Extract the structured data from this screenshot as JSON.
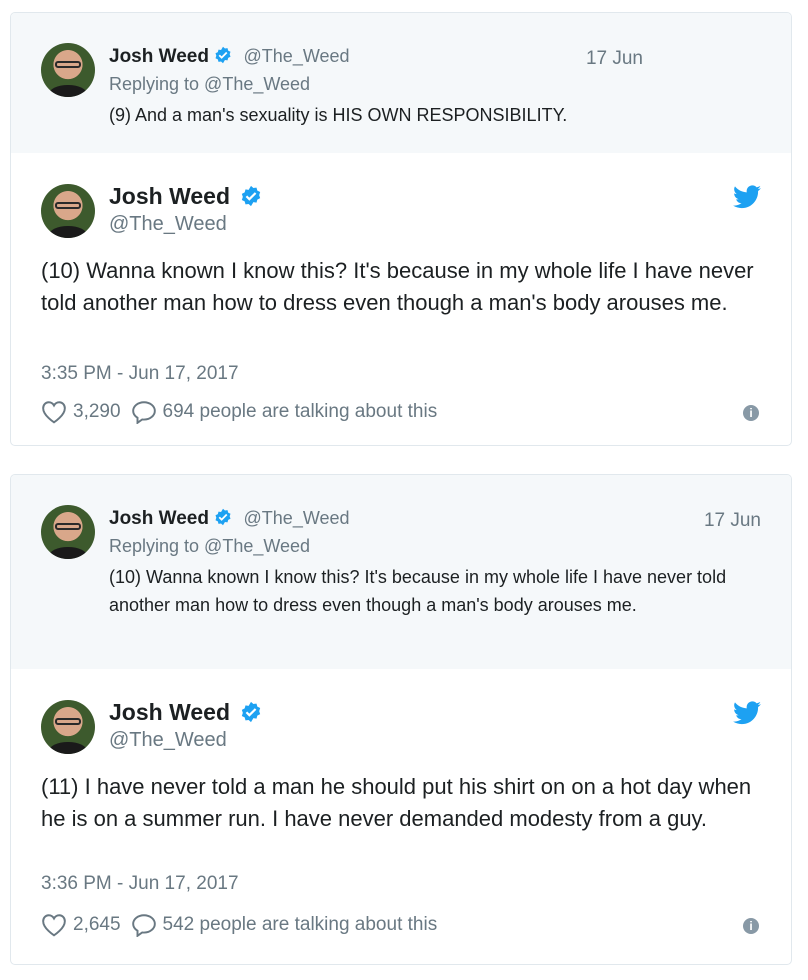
{
  "tweets": [
    {
      "reply": {
        "name": "Josh Weed",
        "handle": "@The_Weed",
        "date": "17 Jun",
        "replying_to": "Replying to @The_Weed",
        "text": "(9) And a man's sexuality is HIS OWN RESPONSIBILITY."
      },
      "main": {
        "name": "Josh Weed",
        "handle": "@The_Weed",
        "text": "(10) Wanna known I know this? It's because in my whole life I have never told another man how to dress even though a man's body arouses me.",
        "time": "3:35 PM - Jun 17, 2017",
        "likes": "3,290",
        "talking": "694 people are talking about this"
      }
    },
    {
      "reply": {
        "name": "Josh Weed",
        "handle": "@The_Weed",
        "date": "17 Jun",
        "replying_to": "Replying to @The_Weed",
        "text": "(10) Wanna known I know this? It's because in my whole life I have never told another man how to dress even though a man's body arouses me."
      },
      "main": {
        "name": "Josh Weed",
        "handle": "@The_Weed",
        "text": "(11) I have never told a man he should put his shirt on on a hot day when he is on a summer run. I have never demanded modesty from a guy.",
        "time": "3:36 PM - Jun 17, 2017",
        "likes": "2,645",
        "talking": "542 people are talking about this"
      }
    }
  ],
  "icons": {
    "verified": "verified-badge-icon",
    "twitter": "twitter-bird-icon",
    "like": "heart-icon",
    "reply": "speech-bubble-icon",
    "info": "info-icon"
  },
  "colors": {
    "twitter_blue": "#1da1f2",
    "muted_text": "#697882",
    "reply_bg": "#f5f8fa",
    "border": "#e1e8ed"
  }
}
